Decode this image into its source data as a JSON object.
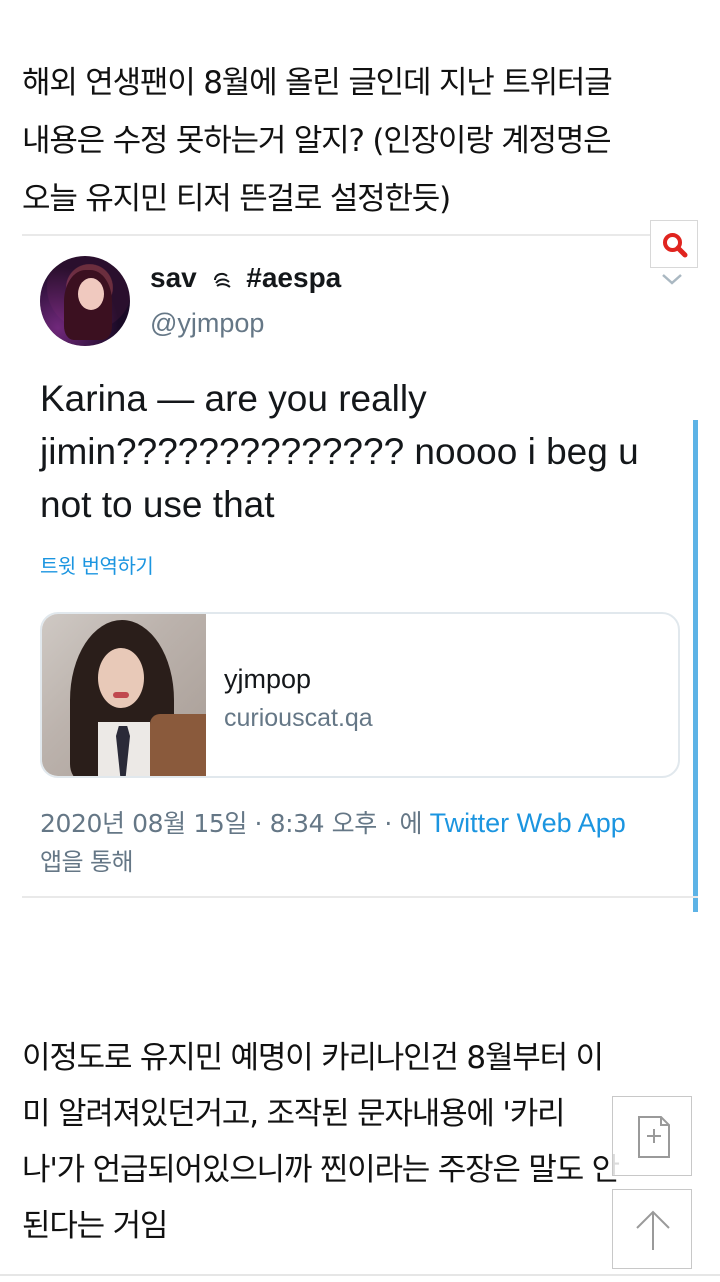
{
  "intro": {
    "lines": [
      "해외 연생팬이 8월에 올린 글인데 지난 트위터글",
      "내용은 수정 못하는거 알지? (인장이랑 계정명은",
      "오늘 유지민 티저 뜬걸로 설정한듯)"
    ]
  },
  "tweet": {
    "display_name": "sav",
    "tag": "#aespa",
    "handle": "@yjmpop",
    "text_lines": [
      "Karina — are you really",
      "jimin?????????????? noooo i beg u",
      "not to use that"
    ],
    "translate_label": "트윗 번역하기",
    "card": {
      "title": "yjmpop",
      "domain": "curiouscat.qa"
    },
    "meta": {
      "datetime": "2020년 08월 15일 · 8:34 오후 · 에 ",
      "app": "Twitter Web App",
      "suffix": "앱을 통해"
    }
  },
  "outro": {
    "lines": [
      "이정도로 유지민 예명이 카리나인건 8월부터 이",
      "미 알려져있던거고, 조작된 문자내용에 '카리",
      "나'가 언급되어있으니까 찐이라는 주장은 말도 안",
      "된다는 거임"
    ]
  },
  "icons": {
    "search": "search-icon",
    "chevron": "chevron-down-icon",
    "add_bookmark": "add-bookmark-icon",
    "scroll_top": "arrow-up-icon"
  },
  "colors": {
    "link": "#1b95e0",
    "muted": "#657786",
    "search_icon": "#e0241f",
    "scroll_indicator": "#5db3e6"
  }
}
